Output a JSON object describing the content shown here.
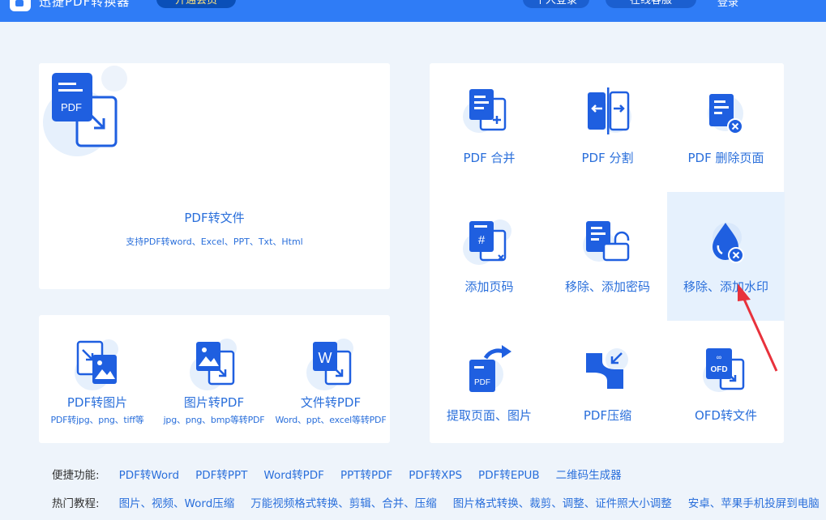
{
  "app": {
    "title": "迅捷PDF转换器",
    "vip_label": "开通会员",
    "top_buttons": [
      "个人登录",
      "在线客服"
    ],
    "top_texts": [
      "登录",
      "—"
    ]
  },
  "main_feature": {
    "icon_text": "PDF",
    "title": "PDF转文件",
    "subtitle": "支持PDF转word、Excel、PPT、Txt、Html"
  },
  "convert_items": [
    {
      "label": "PDF转图片",
      "sub": "PDF转jpg、png、tiff等"
    },
    {
      "label": "图片转PDF",
      "sub": "jpg、png、bmp等转PDF"
    },
    {
      "label": "文件转PDF",
      "sub": "Word、ppt、excel等转PDF"
    }
  ],
  "tools": [
    {
      "label": "PDF 合并"
    },
    {
      "label": "PDF 分割"
    },
    {
      "label": "PDF 删除页面"
    },
    {
      "label": "添加页码"
    },
    {
      "label": "移除、添加密码"
    },
    {
      "label": "移除、添加水印"
    },
    {
      "label": "提取页面、图片"
    },
    {
      "label": "PDF压缩"
    },
    {
      "label": "OFD转文件"
    }
  ],
  "tool_icon_texts": {
    "number": "#",
    "pdf": "PDF",
    "ofd": "OFD",
    "word": "W"
  },
  "shortcuts": {
    "heading": "便捷功能:",
    "links": [
      "PDF转Word",
      "PDF转PPT",
      "Word转PDF",
      "PPT转PDF",
      "PDF转XPS",
      "PDF转EPUB",
      "二维码生成器"
    ]
  },
  "tutorials": {
    "heading": "热门教程:",
    "links": [
      "图片、视频、Word压缩",
      "万能视频格式转换、剪辑、合并、压缩",
      "图片格式转换、裁剪、调整、证件照大小调整",
      "安卓、苹果手机投屏到电脑"
    ]
  },
  "colors": {
    "accent": "#2a6fdb",
    "primary_blue": "#1f5fe0",
    "topbar": "#2f7cf6",
    "arrow_annotation": "#e8323c"
  }
}
